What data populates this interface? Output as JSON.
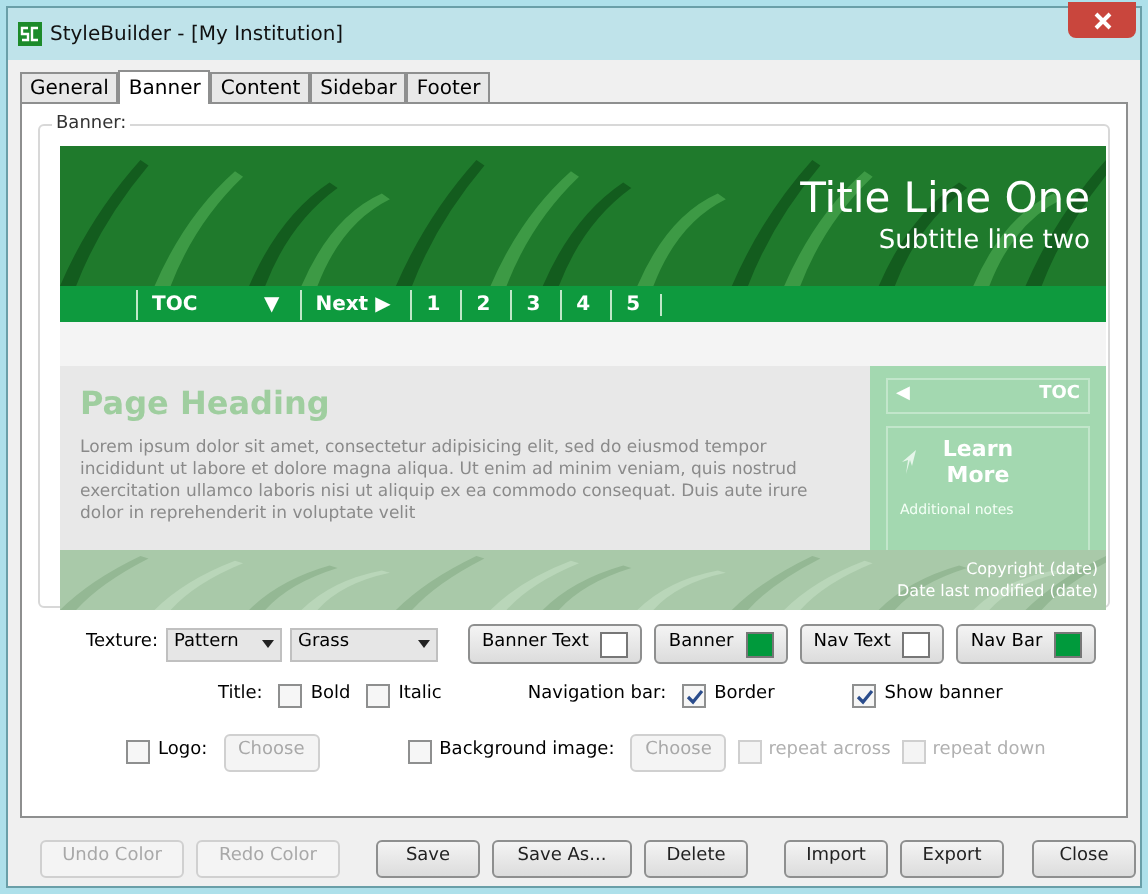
{
  "window": {
    "title": "StyleBuilder - [My Institution]"
  },
  "tabs": [
    {
      "label": "General",
      "selected": false
    },
    {
      "label": "Banner",
      "selected": true
    },
    {
      "label": "Content",
      "selected": false
    },
    {
      "label": "Sidebar",
      "selected": false
    },
    {
      "label": "Footer",
      "selected": false
    }
  ],
  "group_label": "Banner:",
  "preview": {
    "title": "Title Line One",
    "subtitle": "Subtitle line two",
    "nav_items": [
      "TOC",
      "▼",
      "Next ▶",
      "1",
      "2",
      "3",
      "4",
      "5"
    ],
    "heading": "Page Heading",
    "body": "Lorem ipsum dolor sit amet, consectetur adipisicing elit, sed do eiusmod tempor incididunt ut labore et dolore magna aliqua. Ut enim ad minim veniam, quis nostrud exercitation ullamco laboris nisi ut aliquip ex ea commodo consequat. Duis aute irure dolor in reprehenderit in voluptate velit",
    "sidebar": {
      "toc_arrow": "◀",
      "toc": "TOC",
      "learn_more": "Learn More",
      "notes": "Additional notes"
    },
    "footer": [
      "Copyright (date)",
      "Date last modified (date)"
    ]
  },
  "texture": {
    "label": "Texture:",
    "type": "Pattern",
    "name": "Grass"
  },
  "color_buttons": [
    {
      "label": "Banner Text",
      "color": "#ffffff"
    },
    {
      "label": "Banner",
      "color": "#009a3c"
    },
    {
      "label": "Nav Text",
      "color": "#ffffff"
    },
    {
      "label": "Nav Bar",
      "color": "#009a3c"
    }
  ],
  "title_options": {
    "label": "Title:",
    "options": [
      {
        "label": "Bold",
        "checked": false
      },
      {
        "label": "Italic",
        "checked": false
      }
    ]
  },
  "nav_options": {
    "label": "Navigation bar:",
    "options": [
      {
        "label": "Border",
        "checked": true
      }
    ]
  },
  "show_banner": {
    "label": "Show banner",
    "checked": true
  },
  "logo": {
    "label": "Logo:",
    "checked": false,
    "button": "Choose"
  },
  "background": {
    "label": "Background image:",
    "checked": false,
    "button": "Choose",
    "options": [
      {
        "label": "repeat across",
        "checked": false,
        "disabled": true
      },
      {
        "label": "repeat down",
        "checked": false,
        "disabled": true
      }
    ]
  },
  "buttons": [
    {
      "label": "Undo Color",
      "disabled": true
    },
    {
      "label": "Redo Color",
      "disabled": true
    },
    {
      "label": "Save",
      "disabled": false
    },
    {
      "label": "Save As...",
      "disabled": false
    },
    {
      "label": "Delete",
      "disabled": false
    },
    {
      "label": "Import",
      "disabled": false
    },
    {
      "label": "Export",
      "disabled": false
    },
    {
      "label": "Close",
      "disabled": false
    }
  ]
}
